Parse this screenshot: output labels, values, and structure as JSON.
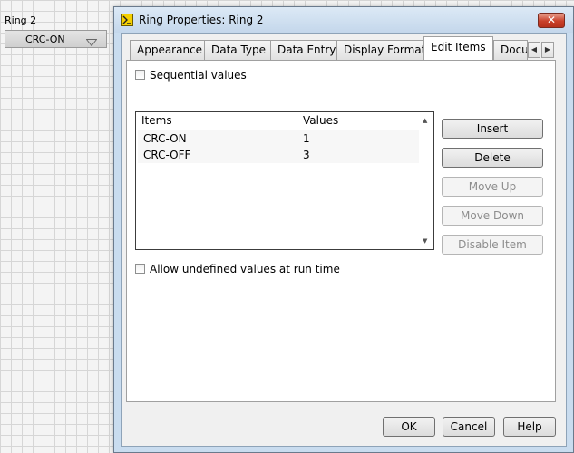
{
  "front_panel": {
    "label": "Ring 2",
    "ring_value": "CRC-ON"
  },
  "dialog": {
    "title": "Ring Properties: Ring 2",
    "close_glyph": "✕",
    "tabs": [
      {
        "label": "Appearance"
      },
      {
        "label": "Data Type"
      },
      {
        "label": "Data Entry"
      },
      {
        "label": "Display Format"
      },
      {
        "label": "Edit Items",
        "active": true
      },
      {
        "label": "Docu"
      }
    ],
    "sequential_values_label": "Sequential values",
    "list": {
      "headers": [
        "Items",
        "Values"
      ],
      "rows": [
        {
          "item": "CRC-ON",
          "value": "1"
        },
        {
          "item": "CRC-OFF",
          "value": "3"
        }
      ]
    },
    "side_buttons": {
      "insert": "Insert",
      "delete": "Delete",
      "move_up": "Move Up",
      "move_down": "Move Down",
      "disable_item": "Disable Item"
    },
    "allow_undefined_label": "Allow undefined values at run time",
    "footer": {
      "ok": "OK",
      "cancel": "Cancel",
      "help": "Help"
    }
  },
  "colors": {
    "dialog_frame": "#c9dcef",
    "close_button": "#c9402a",
    "disabled_text": "#8d8d8d"
  }
}
